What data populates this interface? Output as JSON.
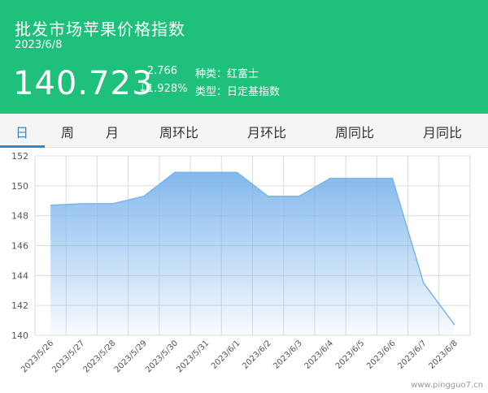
{
  "header": {
    "title": "批发市场苹果价格指数",
    "date": "2023/6/8",
    "price": "140.723",
    "change": "- 2.766",
    "change_pct": "↓1.928%",
    "kind": "种类：红富士",
    "type": "类型：日定基指数",
    "bg_color": "#1fc07b"
  },
  "tabs": [
    {
      "label": "日",
      "active": true
    },
    {
      "label": "周",
      "active": false
    },
    {
      "label": "月",
      "active": false
    },
    {
      "label": "周环比",
      "active": false
    },
    {
      "label": "月环比",
      "active": false
    },
    {
      "label": "周同比",
      "active": false
    },
    {
      "label": "月同比",
      "active": false
    }
  ],
  "watermark": "www.pingguo7.cn",
  "chart_data": {
    "type": "area",
    "categories": [
      "2023/5/26",
      "2023/5/27",
      "2023/5/28",
      "2023/5/29",
      "2023/5/30",
      "2023/5/31",
      "2023/6/1",
      "2023/6/2",
      "2023/6/3",
      "2023/6/4",
      "2023/6/5",
      "2023/6/6",
      "2023/6/7",
      "2023/6/8"
    ],
    "series": [
      {
        "values": [
          148.7,
          148.8,
          148.8,
          149.3,
          150.9,
          150.9,
          150.9,
          149.3,
          149.3,
          150.5,
          150.5,
          150.5,
          143.5,
          140.7
        ]
      }
    ],
    "ylim": [
      140,
      152
    ],
    "yticks": [
      140,
      142,
      144,
      146,
      148,
      150,
      152
    ],
    "grid": true,
    "line_color": "#7cb5ec"
  }
}
